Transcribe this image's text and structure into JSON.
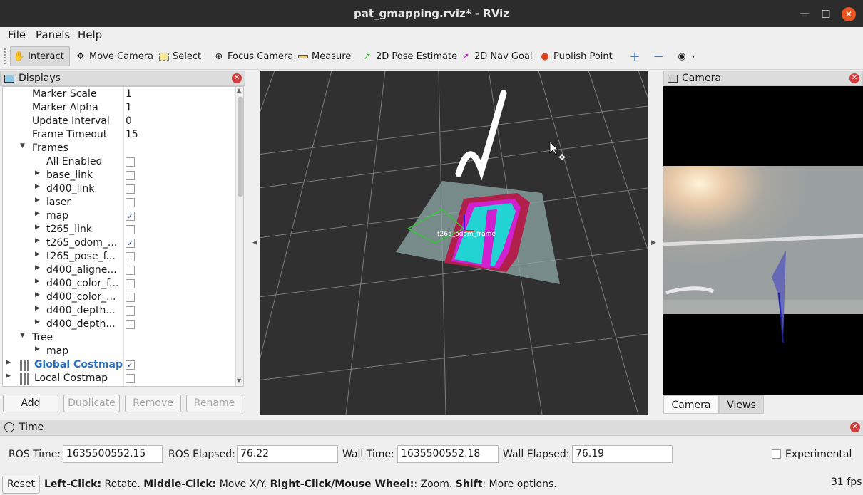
{
  "window": {
    "title": "pat_gmapping.rviz* - RViz"
  },
  "menu": {
    "file": "File",
    "panels": "Panels",
    "help": "Help"
  },
  "toolbar": {
    "interact": "Interact",
    "move_camera": "Move Camera",
    "select": "Select",
    "focus_camera": "Focus Camera",
    "measure": "Measure",
    "pose_estimate": "2D Pose Estimate",
    "nav_goal": "2D Nav Goal",
    "publish_point": "Publish Point"
  },
  "displays": {
    "title": "Displays",
    "rows": [
      {
        "name": "Marker Scale",
        "value": "1"
      },
      {
        "name": "Marker Alpha",
        "value": "1"
      },
      {
        "name": "Update Interval",
        "value": "0"
      },
      {
        "name": "Frame Timeout",
        "value": "15"
      },
      {
        "name": "Frames"
      },
      {
        "name": "All Enabled",
        "checked": false
      },
      {
        "name": "base_link",
        "checked": false
      },
      {
        "name": "d400_link",
        "checked": false
      },
      {
        "name": "laser",
        "checked": false
      },
      {
        "name": "map",
        "checked": true
      },
      {
        "name": "t265_link",
        "checked": false
      },
      {
        "name": "t265_odom_...",
        "checked": true
      },
      {
        "name": "t265_pose_f...",
        "checked": false
      },
      {
        "name": "d400_aligne...",
        "checked": false
      },
      {
        "name": "d400_color_f...",
        "checked": false
      },
      {
        "name": "d400_color_...",
        "checked": false
      },
      {
        "name": "d400_depth...",
        "checked": false
      },
      {
        "name": "d400_depth...",
        "checked": false
      },
      {
        "name": "Tree"
      },
      {
        "name": "map"
      },
      {
        "name": "Global Costmap",
        "checked": true
      },
      {
        "name": "Local Costmap",
        "checked": false
      }
    ],
    "buttons": {
      "add": "Add",
      "duplicate": "Duplicate",
      "remove": "Remove",
      "rename": "Rename"
    }
  },
  "viewport": {
    "frame_label": "t265_odom_frame"
  },
  "camera": {
    "title": "Camera",
    "tab_camera": "Camera",
    "tab_views": "Views"
  },
  "time": {
    "title": "Time",
    "ros_time_label": "ROS Time:",
    "ros_time": "1635500552.15",
    "ros_elapsed_label": "ROS Elapsed:",
    "ros_elapsed": "76.22",
    "wall_time_label": "Wall Time:",
    "wall_time": "1635500552.18",
    "wall_elapsed_label": "Wall Elapsed:",
    "wall_elapsed": "76.19",
    "experimental": "Experimental"
  },
  "status": {
    "reset": "Reset",
    "left_click_key": "Left-Click:",
    "left_click": " Rotate. ",
    "middle_click_key": "Middle-Click:",
    "middle_click": " Move X/Y. ",
    "right_click_key": "Right-Click/Mouse Wheel:",
    "right_click": ": Zoom. ",
    "shift_key": "Shift",
    "shift": ": More options.",
    "fps": "31 fps"
  },
  "colors": {
    "accent": "#e95420",
    "costmap_cyan": "#22d3d3",
    "costmap_magenta": "#d020d0",
    "costmap_red": "#b0204a",
    "link_blue": "#2a6ebd"
  }
}
